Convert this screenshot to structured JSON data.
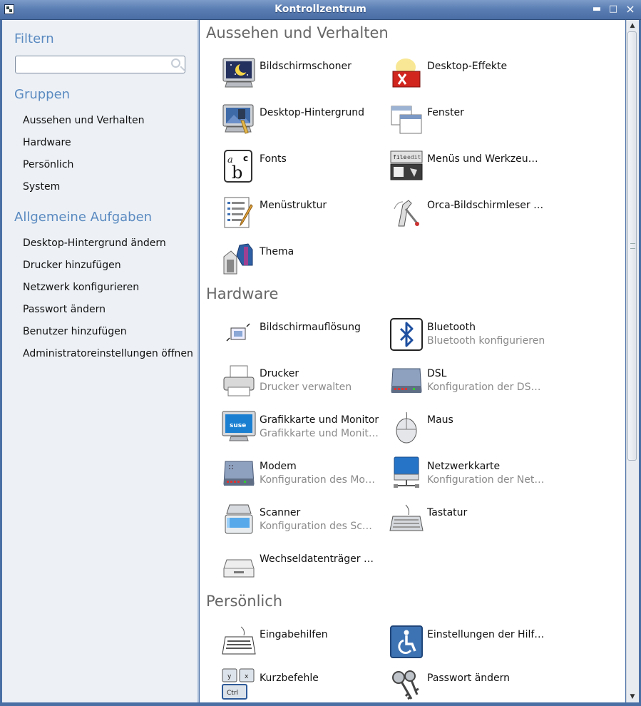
{
  "window": {
    "title": "Kontrollzentrum"
  },
  "sidebar": {
    "filter_heading": "Filtern",
    "search": {
      "value": "",
      "placeholder": ""
    },
    "groups_heading": "Gruppen",
    "groups": [
      "Aussehen und Verhalten",
      "Hardware",
      "Persönlich",
      "System"
    ],
    "tasks_heading": "Allgemeine Aufgaben",
    "tasks": [
      "Desktop-Hintergrund ändern",
      "Drucker hinzufügen",
      "Netzwerk konfigurieren",
      "Passwort ändern",
      "Benutzer hinzufügen",
      "Administratoreinstellungen öffnen"
    ]
  },
  "categories": [
    {
      "title": "Aussehen und Verhalten",
      "items": [
        {
          "name": "Bildschirmschoner",
          "desc": "",
          "icon": "screensaver-icon"
        },
        {
          "name": "Desktop-Effekte",
          "desc": "",
          "icon": "desktop-effects-icon"
        },
        {
          "name": "Desktop-Hintergrund",
          "desc": "",
          "icon": "desktop-background-icon"
        },
        {
          "name": "Fenster",
          "desc": "",
          "icon": "windows-icon"
        },
        {
          "name": "Fonts",
          "desc": "",
          "icon": "fonts-icon"
        },
        {
          "name": "Menüs und Werkzeu…",
          "desc": "",
          "icon": "menus-toolbars-icon"
        },
        {
          "name": "Menüstruktur",
          "desc": "",
          "icon": "menu-structure-icon"
        },
        {
          "name": "Orca-Bildschirmleser …",
          "desc": "",
          "icon": "orca-screen-reader-icon"
        },
        {
          "name": "Thema",
          "desc": "",
          "icon": "theme-icon"
        }
      ]
    },
    {
      "title": "Hardware",
      "items": [
        {
          "name": "Bildschirmauflösung",
          "desc": "",
          "icon": "screen-resolution-icon"
        },
        {
          "name": "Bluetooth",
          "desc": "Bluetooth konfigurieren",
          "icon": "bluetooth-icon"
        },
        {
          "name": "Drucker",
          "desc": "Drucker verwalten",
          "icon": "printer-icon"
        },
        {
          "name": "DSL",
          "desc": "Konfiguration der DS…",
          "icon": "dsl-icon"
        },
        {
          "name": "Grafikkarte und Monitor",
          "desc": "Grafikkarte und Monit…",
          "icon": "monitor-icon"
        },
        {
          "name": "Maus",
          "desc": "",
          "icon": "mouse-icon"
        },
        {
          "name": "Modem",
          "desc": "Konfiguration des Mo…",
          "icon": "modem-icon"
        },
        {
          "name": "Netzwerkkarte",
          "desc": "Konfiguration der Net…",
          "icon": "network-card-icon"
        },
        {
          "name": "Scanner",
          "desc": "Konfiguration des Sc…",
          "icon": "scanner-icon"
        },
        {
          "name": "Tastatur",
          "desc": "",
          "icon": "keyboard-icon"
        },
        {
          "name": "Wechseldatenträger …",
          "desc": "",
          "icon": "removable-drive-icon"
        }
      ]
    },
    {
      "title": "Persönlich",
      "items": [
        {
          "name": "Eingabehilfen",
          "desc": "",
          "icon": "input-assistance-icon"
        },
        {
          "name": "Einstellungen der Hilf…",
          "desc": "",
          "icon": "accessibility-icon"
        },
        {
          "name": "Kurzbefehle",
          "desc": "",
          "icon": "shortcuts-icon"
        },
        {
          "name": "Passwort ändern",
          "desc": "",
          "icon": "keys-icon"
        }
      ]
    }
  ],
  "icon_labels": {
    "fonts": [
      "a",
      "b",
      "c"
    ],
    "menu_bar": [
      "file",
      "edit"
    ],
    "shortcut_keys": [
      "y",
      "x",
      "Ctrl"
    ],
    "suse": "suse"
  }
}
